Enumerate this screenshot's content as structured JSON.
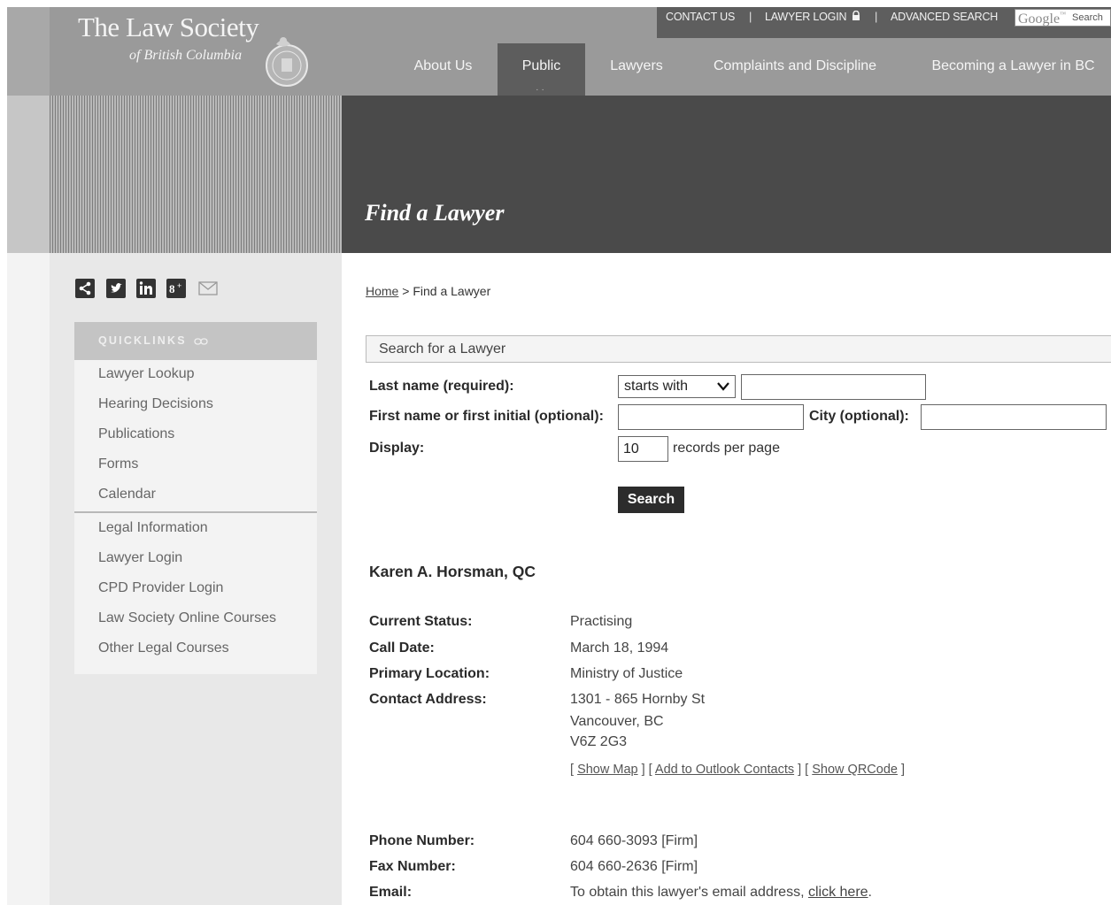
{
  "header": {
    "logo_title": "The Law Society",
    "logo_subtitle": "of British Columbia",
    "utility": {
      "contact": "CONTACT US",
      "login": "LAWYER LOGIN",
      "advanced": "ADVANCED SEARCH",
      "sep": "|",
      "google_logo": "Google",
      "google_tm": "™",
      "google_search": "Search"
    },
    "nav": [
      {
        "label": "About Us"
      },
      {
        "label": "Public",
        "active": true
      },
      {
        "label": "Lawyers"
      },
      {
        "label": "Complaints and Discipline"
      },
      {
        "label": "Becoming a Lawyer in BC"
      }
    ]
  },
  "banner": {
    "title": "Find a Lawyer"
  },
  "sidebar": {
    "share_icons": [
      "share-icon",
      "twitter-icon",
      "linkedin-icon",
      "google-plus-icon",
      "email-icon"
    ],
    "quicklinks_heading": "QUICKLINKS",
    "quicklinks_group1": [
      "Lawyer Lookup",
      "Hearing Decisions",
      "Publications",
      "Forms",
      "Calendar"
    ],
    "quicklinks_group2": [
      "Legal Information",
      "Lawyer Login",
      "CPD Provider Login",
      "Law Society Online Courses",
      "Other Legal Courses"
    ]
  },
  "breadcrumb": {
    "home": "Home",
    "sep": ">",
    "current": "Find a Lawyer"
  },
  "search_form": {
    "panel_title": "Search for a Lawyer",
    "last_name_label": "Last name (required):",
    "match_option": "starts with",
    "first_name_label": "First name or first initial (optional):",
    "city_label": "City (optional):",
    "display_label": "Display:",
    "display_value": "10",
    "records_label": "records per page",
    "search_button": "Search"
  },
  "lawyer": {
    "name": "Karen A. Horsman, QC",
    "status_label": "Current Status:",
    "status": "Practising",
    "call_label": "Call Date:",
    "call_date": "March 18, 1994",
    "location_label": "Primary Location:",
    "location": "Ministry of Justice",
    "address_label": "Contact Address:",
    "address_line1": "1301 - 865 Hornby St",
    "address_line2": "Vancouver, BC",
    "address_line3": "V6Z 2G3",
    "show_map": "Show Map",
    "add_outlook": "Add to Outlook Contacts",
    "show_qr": "Show QRCode",
    "phone_label": "Phone Number:",
    "phone": "604 660-3093 [Firm]",
    "fax_label": "Fax Number:",
    "fax": "604 660-2636 [Firm]",
    "email_label": "Email:",
    "email_text": "To obtain this lawyer's email address,",
    "email_link": "click here",
    "email_end": "."
  }
}
